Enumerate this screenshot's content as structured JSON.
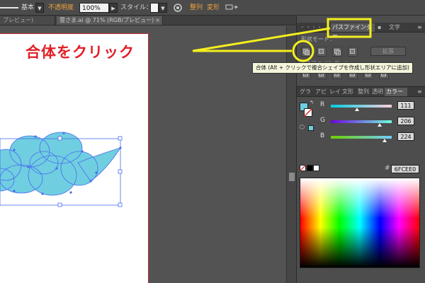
{
  "control_bar": {
    "stroke_style": "基本",
    "opacity_label": "不透明度",
    "opacity_value": "100%",
    "style_label": "スタイル：",
    "align_label": "整列",
    "transform_label": "変形"
  },
  "doc_tabs": [
    {
      "label": "ブレビュー)"
    },
    {
      "label": "雲さま.ai @ 71% (RGB/プレビュー)"
    }
  ],
  "pathfinder": {
    "tab_label": "パスファインダー",
    "text_tab": "文字",
    "shape_modes_label": "形状モード：",
    "apply_label": "拡張"
  },
  "annotation": {
    "instruction": "合体をクリック",
    "tooltip": "合体 (Alt + クリックで複合シェイプを作成し形状エリアに追加)",
    "highlight_color": "#f4ef1d",
    "text_color": "#e21f26"
  },
  "color_panel": {
    "tabs": [
      "グラ",
      "アピ",
      "レイ",
      "文形",
      "整列",
      "透明",
      "カラー"
    ],
    "channels": [
      {
        "name": "R",
        "value": "111",
        "fraction": 0.435,
        "from": "#00cee0",
        "to": "#ffcee0"
      },
      {
        "name": "G",
        "value": "206",
        "fraction": 0.808,
        "from": "#6f00e0",
        "to": "#6fffe0"
      },
      {
        "name": "B",
        "value": "224",
        "fraction": 0.878,
        "from": "#6fce00",
        "to": "#6fceff"
      }
    ],
    "hex_prefix": "#",
    "hex": "6FCEE0",
    "fill_color": "#6fcee0"
  },
  "cloud": {
    "fill": "#6fcee0",
    "selection_color": "#4a6cf0"
  }
}
